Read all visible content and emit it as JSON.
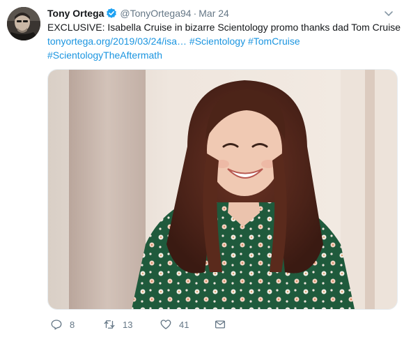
{
  "tweet": {
    "display_name": "Tony Ortega",
    "verified": true,
    "handle": "@TonyOrtega94",
    "separator": "·",
    "date": "Mar 24",
    "text_line1": "EXCLUSIVE: Isabella Cruise in bizarre Scientology promo thanks dad Tom Cruise",
    "link_url": "tonyortega.org/2019/03/24/isa…",
    "hashtag1": "#Scientology",
    "hashtag2": "#TomCruise",
    "hashtag3": "#ScientologyTheAftermath"
  },
  "actions": {
    "reply_count": "8",
    "retweet_count": "13",
    "like_count": "41"
  },
  "colors": {
    "link": "#1b95e0",
    "verified": "#1da1f2",
    "muted": "#657786"
  },
  "icons": {
    "avatar": "user-photo",
    "verified": "verified-badge-icon",
    "caret": "chevron-down-icon",
    "reply": "reply-icon",
    "retweet": "retweet-icon",
    "like": "heart-icon",
    "dm": "envelope-icon"
  }
}
